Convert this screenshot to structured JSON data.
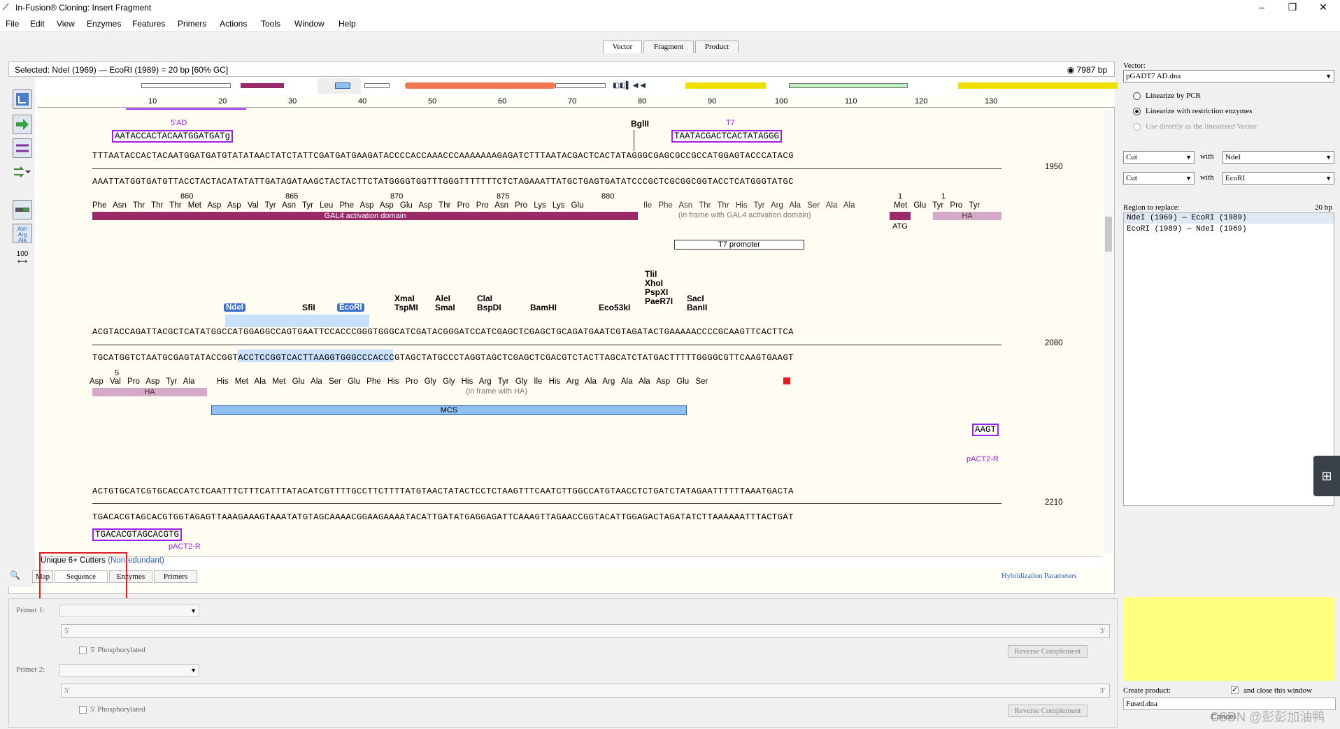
{
  "window": {
    "title": "In-Fusion® Cloning: Insert Fragment",
    "minimize": "–",
    "restore": "❐",
    "close": "✕"
  },
  "menu": [
    "File",
    "Edit",
    "View",
    "Enzymes",
    "Features",
    "Primers",
    "Actions",
    "Tools",
    "Window",
    "Help"
  ],
  "tabs": {
    "vector": "Vector",
    "fragment": "Fragment",
    "product": "Product"
  },
  "selection": {
    "text": "Selected:  NdeI (1969)  —  EcoRI (1989)  =  20 bp     [60% GC]",
    "length": "7987 bp"
  },
  "ruler": [
    "10",
    "20",
    "30",
    "40",
    "50",
    "60",
    "70",
    "80",
    "90",
    "100",
    "110",
    "120",
    "130"
  ],
  "block1": {
    "primer_5ad_label": "5'AD",
    "primer_5ad_seq": "AATACCACTACAATGGATGATg",
    "primer_t7_label": "T7",
    "primer_t7_seq": "TAATACGACTCACTATAGGG",
    "enz_bglii": "BglII",
    "top": "TTTAATACCACTACAATGGATGATGTATATAACTATCTATTCGATGATGAAGATACCCCACCAAACCCAAAAAAAGAGATCTTTAATACGACTCACTATAGGGCGAGCGCCGCCATGGAGTACCCATACG",
    "bottom": "AAATTATGGTGATGTTACCTACTACATATATTGATAGATAAGCTACTACTTCTATGGGGTGGTTTGGGTTTTTTTCTCTAGAAATTATGCTGAGTGATATCCCGCTCGCGGCGGTACCTCATGGGTATGC",
    "pos": "1950",
    "aa_nums": [
      "860",
      "865",
      "870",
      "875",
      "880",
      "1",
      "1"
    ],
    "aa": "Phe Asn Thr Thr Thr Met Asp Asp Val Tyr Asn Tyr Leu Phe Asp Asp Glu Asp Thr Pro Pro Asn Pro Lys Lys Glu",
    "aa2": "Ile Phe Asn Thr Thr His Tyr Arg Ala Ser Ala Ala",
    "aa3": "Met Glu Tyr Pro Tyr",
    "feat_gal4": "GAL4 activation domain",
    "inframe_gal4": "(in frame with GAL4 activation domain)",
    "atg": "ATG",
    "ha": "HA",
    "t7_promoter": "T7 promoter"
  },
  "block2": {
    "enz_ndei": "NdeI",
    "enz_sfii": "SfiI",
    "enz_ecori": "EcoRI",
    "enz_xmai": "XmaI\nTspMI",
    "enz_alei": "AleI\nSmaI",
    "enz_clai": "ClaI\nBspDI",
    "enz_bamhi": "BamHI",
    "enz_eco53ki": "Eco53kI",
    "enz_tlii": "TliI\nXhoI\nPspXI\nPaeR7I",
    "enz_saci": "SacI\nBanII",
    "top": "ACGTACCAGATTACGCTCATATGGCCATGGAGGCCAGTGAATTCCACCCGGGTGGGCATCGATACGGGATCCATCGAGCTCGAGCTGCAGATGAATCGTAGATACTGAAAAACCCCGCAAGTTCACTTCA",
    "bottom": "TGCATGGTCTAATGCGAGTATACCGGTACCTCCGGTCACTTAAGGTGGGCCCACCCGTAGCTATGCCCTAGGTAGCTCGAGCTCGACGTCTACTTAGCATCTATGACTTTTTGGGGCGTTCAAGTGAAGT",
    "pos": "2080",
    "aa_num": "5",
    "aa": "Asp Val Pro Asp Tyr Ala",
    "aa2": "His Met Ala Met Glu Ala Ser Glu Phe His Pro Gly Gly His Arg Tyr Gly Ile His Arg Ala Arg Ala Ala Asp Glu Ser",
    "ha": "HA",
    "inframe_ha": "(in frame with HA)",
    "mcs": "MCS"
  },
  "block3": {
    "primer_pact2_top": "AAGT",
    "primer_pact2_label": "pACT2-R",
    "top": "ACTGTGCATCGTGCACCATCTCAATTTCTTTCATTTATACATCGTTTTGCCTTCTTTTATGTAACTATACTCCTCTAAGTTTCAATCTTGGCCATGTAACCTCTGATCTATAGAATTTTTTAAATGACTA",
    "bottom": "TGACACGTAGCACGTGGTAGAGTTAAAGAAAGTAAATATGTAGCAAAACGGAAGAAAATACATTGATATGAGGAGATTCAAAGTTAGAACCGGTACATTGGAGACTAGATATCTTAAAAAATTTACTGAT",
    "pos": "2210",
    "primer_pact2_seq": "TGACACGTAGCACGTG",
    "primer_pact2_label2": "pACT2-R"
  },
  "bottom_tabs": {
    "cutters": "Unique 6+ Cutters",
    "nonredundant": "(Nonredundant)",
    "map": "Map",
    "sequence": "Sequence",
    "enzymes": "Enzymes",
    "primers": "Primers",
    "hybridization": "Hybridization Parameters"
  },
  "right": {
    "vector_label": "Vector:",
    "vector_value": "pGADT7 AD.dna",
    "opt1": "Linearize by PCR",
    "opt2": "Linearize with restriction enzymes",
    "opt3": "Use directly as the linearized Vector",
    "cut1": "Cut",
    "with1": "with",
    "enz1": "NdeI",
    "cut2": "Cut",
    "with2": "with",
    "enz2": "EcoRI",
    "region_label": "Region to replace:",
    "region_bp": "20 bp",
    "region1": "NdeI  (1969)  —  EcoRI  (1989)",
    "region2": "EcoRI  (1989)  —  NdeI  (1969)",
    "create_label": "Create product:",
    "close_label": "and close this window",
    "product_name": "Fused.dna",
    "cancel": "Cancel",
    "watermark": "CSDN @彭彭加油鸭"
  },
  "primers": {
    "primer1_label": "Primer 1:",
    "primer2_label": "Primer 2:",
    "five": "5'",
    "three": "3'",
    "phos1": "5' Phosphorylated",
    "phos2": "5' Phosphorylated",
    "rc1": "Reverse Complement",
    "rc2": "Reverse Complement"
  }
}
